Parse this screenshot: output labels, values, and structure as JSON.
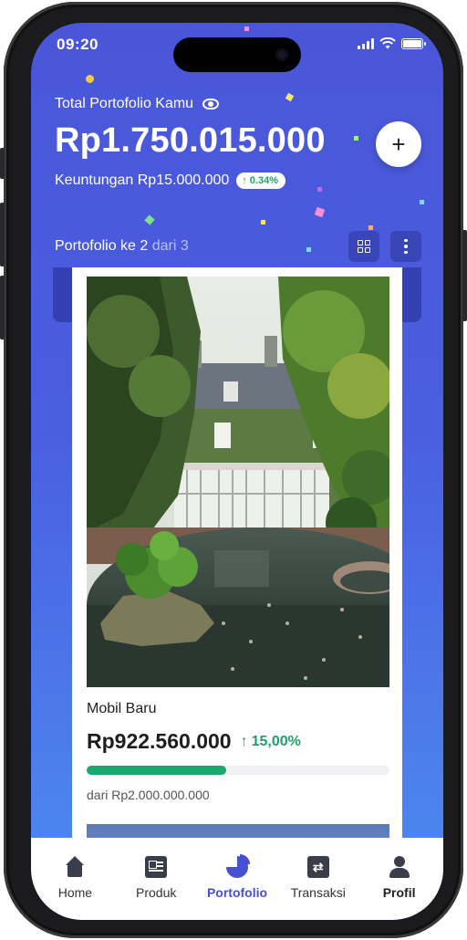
{
  "status_bar": {
    "time": "09:20"
  },
  "header": {
    "total_label": "Total Portofolio Kamu",
    "total_amount": "Rp1.750.015.000",
    "add_label": "+",
    "profit_label": "Keuntungan Rp15.000.000",
    "profit_badge": "0.34%",
    "profit_arrow": "↑"
  },
  "portfolio_nav": {
    "current": "Portofolio ke 2",
    "of_total": "dari 3"
  },
  "card": {
    "title": "Mobil Baru",
    "value": "Rp922.560.000",
    "gain_arrow": "↑",
    "gain": "15,00%",
    "progress": 0.46,
    "target": "dari Rp2.000.000.000"
  },
  "tabs": [
    {
      "label": "Home",
      "icon": "home-icon"
    },
    {
      "label": "Produk",
      "icon": "product-icon"
    },
    {
      "label": "Portofolio",
      "icon": "pie-chart-icon"
    },
    {
      "label": "Transaksi",
      "icon": "transfer-icon"
    },
    {
      "label": "Profil",
      "icon": "profile-icon"
    }
  ],
  "colors": {
    "brand": "#4a56d8",
    "accent_green": "#1aa96d",
    "active_tab": "#4550d3"
  }
}
